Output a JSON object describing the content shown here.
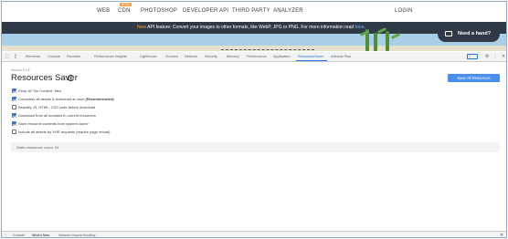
{
  "site": {
    "nav": [
      "WEB",
      "CDN",
      "PHOTOSHOP",
      "DEVELOPER API",
      "THIRD PARTY",
      "ANALYZER"
    ],
    "nav_beta": "BETA",
    "login": "LOGIN",
    "banner": {
      "highlight": "New",
      "text": " API feature: Convert your images to other formats, like WebP, JPG or PNG. For more information read ",
      "link": "here",
      "end": "."
    },
    "help_button": "Need a hand?"
  },
  "devtools": {
    "tabs": [
      "Elements",
      "Console",
      "Recorder",
      "Performance insights",
      "Lighthouse",
      "Sources",
      "Network",
      "Security",
      "Memory",
      "Performance",
      "Application",
      "ResourcesSaver",
      "Adblock Plus"
    ],
    "active_tab": "ResourcesSaver",
    "badge": "1",
    "drawer_tabs": [
      "Console",
      "What's New",
      "Network request blocking"
    ],
    "drawer_active": "What's New",
    "icons": [
      "inspect-icon",
      "device-icon",
      "gear-icon",
      "more-icon",
      "close-icon"
    ]
  },
  "panel": {
    "version": "Version 3.1.8",
    "title": "Resources Saver",
    "save_button": "Save All Resources",
    "options": [
      {
        "label": "Keep all \"No Content\" files",
        "bold": "",
        "checked": true
      },
      {
        "label": "Compress all assets & download at once ",
        "bold": "(Recommended)",
        "checked": true
      },
      {
        "label": "Beautify JS, HTML, CSS code before download",
        "bold": "",
        "checked": false
      },
      {
        "label": "Download from all domains in current resources",
        "bold": "",
        "checked": true
      },
      {
        "label": "Save resource contents from system cache",
        "bold": "",
        "checked": true
      },
      {
        "label": "Include all assets by XHR requests (require page reload)",
        "bold": "",
        "checked": false
      }
    ],
    "status_label": "Static resources count: ",
    "status_count": "94"
  },
  "colors": {
    "accent": "#1a73e8",
    "save_button": "#4a8ef0",
    "banner_bg": "#2f3a46",
    "banner_highlight": "#f4a43a"
  }
}
